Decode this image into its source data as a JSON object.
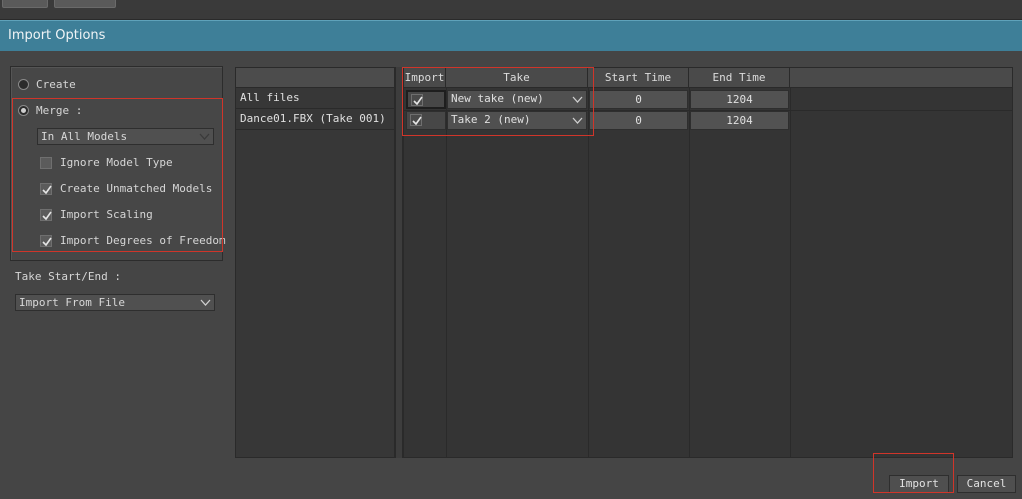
{
  "window": {
    "title": "Import Options"
  },
  "options": {
    "create_label": "Create",
    "create_selected": false,
    "merge_label": "Merge :",
    "merge_selected": true,
    "merge_target": "In All Models",
    "checkboxes": [
      {
        "label": "Ignore Model Type",
        "checked": false
      },
      {
        "label": "Create Unmatched Models",
        "checked": true
      },
      {
        "label": "Import Scaling",
        "checked": true
      },
      {
        "label": "Import Degrees of Freedom",
        "checked": true
      }
    ],
    "take_start_end_label": "Take Start/End :",
    "take_start_end_value": "Import From File"
  },
  "files": {
    "items": [
      "All files",
      "Dance01.FBX (Take 001)"
    ]
  },
  "takes_table": {
    "columns": [
      "Import",
      "Take",
      "Start Time",
      "End Time"
    ],
    "rows": [
      {
        "import": true,
        "take": "New take (new)",
        "start": "0",
        "end": "1204"
      },
      {
        "import": true,
        "take": "Take 2 (new)",
        "start": "0",
        "end": "1204"
      }
    ]
  },
  "buttons": {
    "import": "Import",
    "cancel": "Cancel"
  },
  "colors": {
    "title_bar": "#3e7f98",
    "highlight_box": "#d0352a",
    "panel_bg": "#454545"
  }
}
